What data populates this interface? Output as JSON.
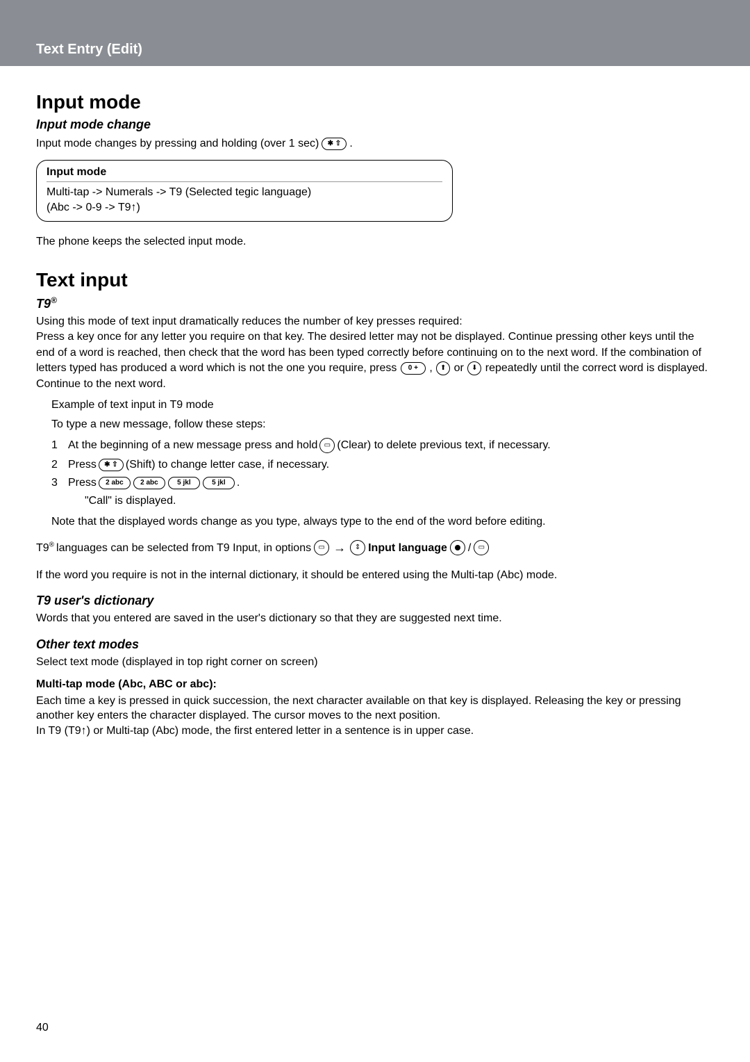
{
  "header": {
    "title": "Text Entry (Edit)"
  },
  "section_input_mode": {
    "heading": "Input mode",
    "change_heading": "Input mode change",
    "change_text_before": "Input mode changes by pressing and holding (over 1 sec) ",
    "change_text_after": ".",
    "box_title": "Input mode",
    "box_line1": "Multi-tap -> Numerals -> T9 (Selected tegic language)",
    "box_line2": "(Abc -> 0-9 -> T9↑)",
    "keep_text": "The phone keeps the selected input mode."
  },
  "section_text_input": {
    "heading": "Text input",
    "t9_heading": "T9",
    "t9_reg": "®",
    "t9_para": "Using this mode of text input dramatically reduces the number of key presses required:\nPress a key once for any letter you require on that key. The desired letter may not be displayed. Continue pressing other keys until the end of a word is reached, then check that the word has been typed correctly before continuing on to the next word. If the combination of letters typed has produced a word which is not the one you require, press ",
    "t9_para_mid1": ", ",
    "t9_para_mid2": " or ",
    "t9_para_tail": " repeatedly until the correct word is displayed. Continue to the next word.",
    "example_title": "Example of text input in T9 mode",
    "example_sub": "To type a new message, follow these steps:",
    "steps": [
      {
        "num": "1",
        "before": "At the beginning of a new message press and hold ",
        "after_icon": "(Clear) to delete previous text, if necessary."
      },
      {
        "num": "2",
        "before": "Press ",
        "after_icon": "(Shift) to change letter case, if necessary."
      },
      {
        "num": "3",
        "before": "Press ",
        "after_icon": "."
      }
    ],
    "step3_result": "\"Call\" is displayed.",
    "note": "Note that the displayed words change as you type, always type to the end of the word before editing.",
    "lang_before": "T9",
    "lang_reg": "®",
    "lang_mid": " languages can be selected from T9 Input, in options ",
    "lang_input_label": " Input language ",
    "lang_slash": " / ",
    "dict_note": "If the word you require is not in the internal dictionary, it should be entered using the Multi-tap (Abc) mode."
  },
  "section_user_dict": {
    "heading": "T9 user's dictionary",
    "text": "Words that you entered are saved in the user's dictionary so that they are suggested next time."
  },
  "section_other": {
    "heading": "Other text modes",
    "text": "Select text mode (displayed in top right corner on screen)",
    "multi_heading": "Multi-tap mode (Abc, ABC or abc):",
    "multi_text": "Each time a key is pressed in quick succession, the next character available on that key is displayed. Releasing the key or pressing another key enters the character displayed. The cursor moves to the next position.\nIn T9 (T9↑) or Multi-tap (Abc) mode, the first entered letter in a sentence is in upper case."
  },
  "icons": {
    "star_shift": "✱ ⇧",
    "zero_plus": "0 +",
    "nav_up": "↑",
    "nav_updown": "↕",
    "nav_down": "↓",
    "clear_key": "⌨",
    "key2": "2 abc",
    "key5": "5 jkl",
    "softkey": "▭",
    "arrow_right": "→",
    "center_dot": "●"
  },
  "page_number": "40"
}
